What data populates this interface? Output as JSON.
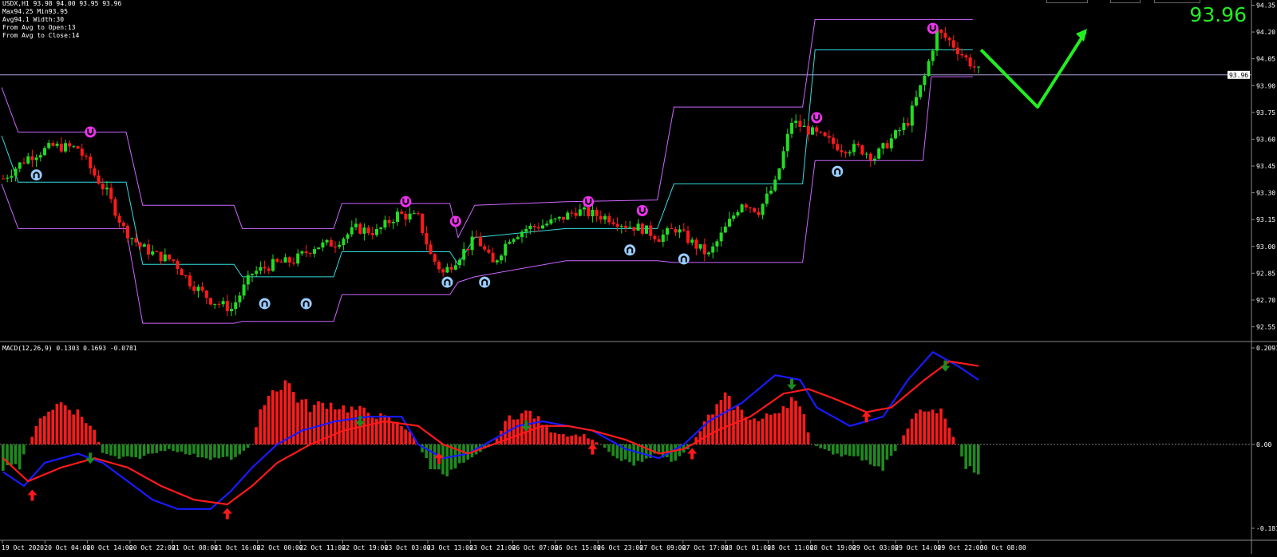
{
  "header": {
    "line1": "USDX,H1  93.98 94.00 93.95 93.96",
    "line2": "Max94.25 Min93.95",
    "line3": "Avg94.1 Width:30",
    "line4": "From Avg to Open:13",
    "line5": "From Avg to Close:14"
  },
  "big_price": "93.96",
  "macd_label": "MACD(12,26,9) 0.1303 0.1693 -0.0781",
  "colors": {
    "bull": "#22dd22",
    "bear": "#ff1a1a",
    "channel": "#cc66ff",
    "avg": "#33dddd",
    "arrow_up": "#99ccff",
    "arrow_dn": "#ee33ee",
    "macd": "#1a1aff",
    "signal": "#ff1a1a",
    "forecast": "#22ee22"
  },
  "price_axis": {
    "labels": [
      "94.35",
      "94.20",
      "94.05",
      "93.90",
      "93.75",
      "93.60",
      "93.45",
      "93.30",
      "93.15",
      "93.00",
      "92.85",
      "92.70",
      "92.55"
    ],
    "current": "93.96"
  },
  "macd_axis": {
    "labels": [
      "0.2091",
      "0.00",
      "-0.1818"
    ]
  },
  "time_axis": {
    "labels": [
      "19 Oct 2020",
      "20 Oct 04:00",
      "20 Oct 14:00",
      "20 Oct 22:00",
      "21 Oct 08:00",
      "21 Oct 16:00",
      "22 Oct 00:00",
      "22 Oct 11:00",
      "22 Oct 19:00",
      "23 Oct 03:00",
      "23 Oct 13:00",
      "23 Oct 21:00",
      "26 Oct 07:00",
      "26 Oct 15:00",
      "26 Oct 23:00",
      "27 Oct 09:00",
      "27 Oct 17:00",
      "28 Oct 01:00",
      "28 Oct 11:00",
      "28 Oct 19:00",
      "29 Oct 03:00",
      "29 Oct 14:00",
      "29 Oct 22:00",
      "30 Oct 08:00"
    ]
  },
  "chart_data": {
    "type": "candlestick",
    "symbol": "USDX",
    "timeframe": "H1",
    "price_range": [
      92.49,
      94.37
    ],
    "close_path": [
      [
        0,
        93.38
      ],
      [
        6,
        93.5
      ],
      [
        12,
        93.56
      ],
      [
        18,
        93.55
      ],
      [
        22,
        93.4
      ],
      [
        25,
        93.3
      ],
      [
        29,
        93.1
      ],
      [
        33,
        93.0
      ],
      [
        37,
        92.95
      ],
      [
        41,
        92.92
      ],
      [
        45,
        92.8
      ],
      [
        50,
        92.7
      ],
      [
        55,
        92.65
      ],
      [
        60,
        92.85
      ],
      [
        65,
        92.9
      ],
      [
        70,
        92.92
      ],
      [
        75,
        93.0
      ],
      [
        80,
        93.02
      ],
      [
        85,
        93.1
      ],
      [
        90,
        93.08
      ],
      [
        95,
        93.18
      ],
      [
        100,
        93.16
      ],
      [
        103,
        92.95
      ],
      [
        106,
        92.85
      ],
      [
        110,
        92.95
      ],
      [
        114,
        93.05
      ],
      [
        118,
        92.9
      ],
      [
        122,
        93.05
      ],
      [
        126,
        93.1
      ],
      [
        130,
        93.12
      ],
      [
        134,
        93.15
      ],
      [
        138,
        93.2
      ],
      [
        142,
        93.18
      ],
      [
        146,
        93.16
      ],
      [
        150,
        93.12
      ],
      [
        154,
        93.1
      ],
      [
        158,
        93.05
      ],
      [
        162,
        93.1
      ],
      [
        166,
        93.02
      ],
      [
        170,
        92.95
      ],
      [
        174,
        93.1
      ],
      [
        178,
        93.25
      ],
      [
        182,
        93.2
      ],
      [
        186,
        93.35
      ],
      [
        190,
        93.7
      ],
      [
        194,
        93.65
      ],
      [
        198,
        93.6
      ],
      [
        202,
        93.55
      ],
      [
        206,
        93.55
      ],
      [
        210,
        93.5
      ],
      [
        214,
        93.6
      ],
      [
        218,
        93.7
      ],
      [
        222,
        93.95
      ],
      [
        225,
        94.2
      ],
      [
        228,
        94.15
      ],
      [
        232,
        94.05
      ],
      [
        235,
        93.98
      ]
    ],
    "upper_channel_steps": [
      [
        0,
        93.89
      ],
      [
        4,
        93.64
      ],
      [
        30,
        93.64
      ],
      [
        34,
        93.23
      ],
      [
        56,
        93.23
      ],
      [
        58,
        93.1
      ],
      [
        80,
        93.1
      ],
      [
        82,
        93.24
      ],
      [
        108,
        93.24
      ],
      [
        110,
        93.05
      ],
      [
        114,
        93.23
      ],
      [
        136,
        93.25
      ],
      [
        158,
        93.26
      ],
      [
        162,
        93.78
      ],
      [
        193,
        93.78
      ],
      [
        196,
        94.27
      ],
      [
        234,
        94.27
      ]
    ],
    "avg_channel_steps": [
      [
        0,
        93.62
      ],
      [
        4,
        93.36
      ],
      [
        30,
        93.36
      ],
      [
        34,
        92.9
      ],
      [
        56,
        92.9
      ],
      [
        58,
        92.83
      ],
      [
        80,
        92.83
      ],
      [
        82,
        92.97
      ],
      [
        108,
        92.97
      ],
      [
        110,
        92.9
      ],
      [
        114,
        93.05
      ],
      [
        136,
        93.1
      ],
      [
        158,
        93.1
      ],
      [
        162,
        93.35
      ],
      [
        193,
        93.35
      ],
      [
        196,
        94.1
      ],
      [
        234,
        94.1
      ]
    ],
    "lower_channel_steps": [
      [
        0,
        93.35
      ],
      [
        4,
        93.1
      ],
      [
        30,
        93.1
      ],
      [
        34,
        92.57
      ],
      [
        56,
        92.57
      ],
      [
        58,
        92.58
      ],
      [
        80,
        92.58
      ],
      [
        82,
        92.73
      ],
      [
        108,
        92.73
      ],
      [
        110,
        92.8
      ],
      [
        114,
        92.83
      ],
      [
        136,
        92.92
      ],
      [
        158,
        92.92
      ],
      [
        162,
        92.91
      ],
      [
        193,
        92.91
      ],
      [
        196,
        93.48
      ],
      [
        222,
        93.48
      ],
      [
        224,
        93.95
      ],
      [
        234,
        93.95
      ]
    ],
    "up_arrows": [
      [
        8,
        93.4
      ],
      [
        63,
        92.68
      ],
      [
        73,
        92.68
      ],
      [
        107,
        92.8
      ],
      [
        116,
        92.8
      ],
      [
        151,
        92.98
      ],
      [
        164,
        92.93
      ],
      [
        201,
        93.42
      ]
    ],
    "down_arrows": [
      [
        21,
        93.64
      ],
      [
        97,
        93.25
      ],
      [
        109,
        93.14
      ],
      [
        141,
        93.25
      ],
      [
        154,
        93.2
      ],
      [
        196,
        93.72
      ],
      [
        224,
        94.22
      ]
    ],
    "macd_range": [
      -0.1818,
      0.2091
    ],
    "macd_histogram_shape": [
      [
        0,
        -0.05
      ],
      [
        4,
        -0.05
      ],
      [
        6,
        0
      ],
      [
        10,
        0.07
      ],
      [
        14,
        0.09
      ],
      [
        18,
        0.07
      ],
      [
        22,
        0.03
      ],
      [
        24,
        -0.02
      ],
      [
        28,
        -0.03
      ],
      [
        32,
        -0.03
      ],
      [
        36,
        -0.02
      ],
      [
        40,
        -0.01
      ],
      [
        44,
        -0.02
      ],
      [
        50,
        -0.03
      ],
      [
        56,
        -0.03
      ],
      [
        60,
        0
      ],
      [
        63,
        0.1
      ],
      [
        68,
        0.14
      ],
      [
        71,
        0.1
      ],
      [
        74,
        0.08
      ],
      [
        78,
        0.09
      ],
      [
        82,
        0.08
      ],
      [
        88,
        0.07
      ],
      [
        94,
        0.05
      ],
      [
        98,
        0.03
      ],
      [
        100,
        0
      ],
      [
        103,
        -0.05
      ],
      [
        106,
        -0.07
      ],
      [
        110,
        -0.04
      ],
      [
        114,
        -0.02
      ],
      [
        118,
        0
      ],
      [
        122,
        0.06
      ],
      [
        127,
        0.07
      ],
      [
        132,
        0.03
      ],
      [
        136,
        0.02
      ],
      [
        140,
        0.02
      ],
      [
        144,
        0
      ],
      [
        148,
        -0.03
      ],
      [
        152,
        -0.04
      ],
      [
        158,
        -0.02
      ],
      [
        162,
        -0.04
      ],
      [
        166,
        0
      ],
      [
        170,
        0.06
      ],
      [
        174,
        0.1
      ],
      [
        178,
        0.07
      ],
      [
        182,
        0.05
      ],
      [
        186,
        0.07
      ],
      [
        190,
        0.1
      ],
      [
        193,
        0.06
      ],
      [
        195,
        0
      ],
      [
        200,
        -0.02
      ],
      [
        206,
        -0.03
      ],
      [
        212,
        -0.05
      ],
      [
        216,
        0
      ],
      [
        218,
        0.04
      ],
      [
        222,
        0.08
      ],
      [
        226,
        0.07
      ],
      [
        230,
        0
      ],
      [
        232,
        -0.05
      ],
      [
        235,
        -0.06
      ]
    ],
    "macd_line": [
      [
        0,
        -0.06
      ],
      [
        5,
        -0.09
      ],
      [
        10,
        -0.04
      ],
      [
        18,
        -0.02
      ],
      [
        24,
        -0.04
      ],
      [
        30,
        -0.08
      ],
      [
        36,
        -0.12
      ],
      [
        42,
        -0.14
      ],
      [
        50,
        -0.14
      ],
      [
        55,
        -0.1
      ],
      [
        60,
        -0.05
      ],
      [
        66,
        0.0
      ],
      [
        72,
        0.03
      ],
      [
        80,
        0.05
      ],
      [
        88,
        0.06
      ],
      [
        96,
        0.06
      ],
      [
        100,
        0.0
      ],
      [
        106,
        -0.03
      ],
      [
        112,
        -0.02
      ],
      [
        118,
        0.01
      ],
      [
        124,
        0.04
      ],
      [
        130,
        0.05
      ],
      [
        136,
        0.04
      ],
      [
        142,
        0.03
      ],
      [
        150,
        -0.01
      ],
      [
        158,
        -0.03
      ],
      [
        164,
        0.0
      ],
      [
        170,
        0.05
      ],
      [
        178,
        0.09
      ],
      [
        186,
        0.15
      ],
      [
        192,
        0.14
      ],
      [
        196,
        0.08
      ],
      [
        204,
        0.04
      ],
      [
        212,
        0.06
      ],
      [
        218,
        0.14
      ],
      [
        224,
        0.2
      ],
      [
        230,
        0.17
      ],
      [
        235,
        0.14
      ]
    ],
    "signal_line": [
      [
        0,
        -0.03
      ],
      [
        6,
        -0.08
      ],
      [
        14,
        -0.05
      ],
      [
        22,
        -0.03
      ],
      [
        30,
        -0.05
      ],
      [
        38,
        -0.09
      ],
      [
        46,
        -0.12
      ],
      [
        54,
        -0.13
      ],
      [
        60,
        -0.09
      ],
      [
        66,
        -0.04
      ],
      [
        74,
        0.0
      ],
      [
        82,
        0.03
      ],
      [
        92,
        0.05
      ],
      [
        100,
        0.04
      ],
      [
        106,
        0.0
      ],
      [
        112,
        -0.02
      ],
      [
        118,
        0.0
      ],
      [
        124,
        0.02
      ],
      [
        130,
        0.04
      ],
      [
        136,
        0.04
      ],
      [
        142,
        0.03
      ],
      [
        150,
        0.01
      ],
      [
        158,
        -0.02
      ],
      [
        164,
        -0.01
      ],
      [
        172,
        0.03
      ],
      [
        180,
        0.06
      ],
      [
        188,
        0.11
      ],
      [
        194,
        0.12
      ],
      [
        200,
        0.1
      ],
      [
        208,
        0.07
      ],
      [
        214,
        0.08
      ],
      [
        222,
        0.14
      ],
      [
        228,
        0.18
      ],
      [
        235,
        0.17
      ]
    ],
    "macd_up_markers": [
      [
        7,
        -0.11
      ],
      [
        54,
        -0.15
      ],
      [
        105,
        -0.03
      ],
      [
        142,
        -0.01
      ],
      [
        166,
        -0.02
      ],
      [
        208,
        0.06
      ]
    ],
    "macd_down_markers": [
      [
        21,
        -0.03
      ],
      [
        86,
        0.05
      ],
      [
        126,
        0.04
      ],
      [
        190,
        0.13
      ],
      [
        227,
        0.17
      ]
    ],
    "forecast_arrow": {
      "from": 94.1,
      "low": 93.78,
      "to": 94.2
    }
  }
}
